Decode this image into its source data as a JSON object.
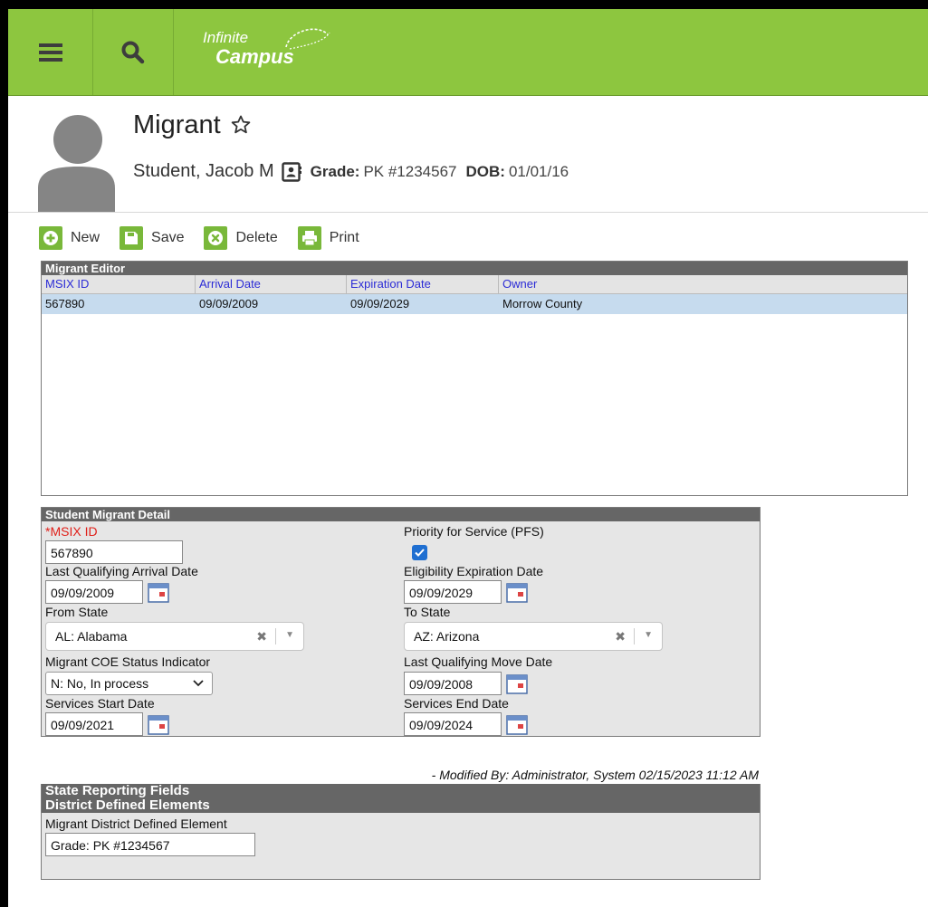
{
  "header": {
    "logo_line1": "Infinite",
    "logo_line2": "Campus",
    "page_title": "Migrant",
    "student_name": "Student, Jacob M",
    "grade_label": "Grade:",
    "grade_value": "PK #1234567",
    "dob_label": "DOB:",
    "dob_value": "01/01/16"
  },
  "toolbar": {
    "new_label": "New",
    "save_label": "Save",
    "delete_label": "Delete",
    "print_label": "Print"
  },
  "editor": {
    "title": "Migrant Editor",
    "columns": [
      "MSIX ID",
      "Arrival Date",
      "Expiration Date",
      "Owner"
    ],
    "rows": [
      [
        "567890",
        "09/09/2009",
        "09/09/2029",
        "Morrow County"
      ]
    ]
  },
  "detail": {
    "title": "Student Migrant Detail",
    "msix_required_mark": "*",
    "msix_label": "MSIX ID",
    "msix_value": "567890",
    "pfs_label": "Priority for Service (PFS)",
    "pfs_checked": true,
    "arrival_label": "Last Qualifying Arrival Date",
    "arrival_value": "09/09/2009",
    "expiration_label": "Eligibility Expiration Date",
    "expiration_value": "09/09/2029",
    "from_state_label": "From State",
    "from_state_value": "AL: Alabama",
    "to_state_label": "To State",
    "to_state_value": "AZ: Arizona",
    "coe_label": "Migrant COE Status Indicator",
    "coe_value": "N: No, In process",
    "move_label": "Last Qualifying Move Date",
    "move_value": "09/09/2008",
    "svc_start_label": "Services Start Date",
    "svc_start_value": "09/09/2021",
    "svc_end_label": "Services End Date",
    "svc_end_value": "09/09/2024",
    "modified_text": "- Modified By: Administrator, System 02/15/2023 11:12 AM"
  },
  "state_reporting": {
    "title": "State Reporting Fields",
    "subtitle": "District Defined Elements",
    "field_label": "Migrant District Defined Element",
    "field_value": "Grade: PK #1234567"
  },
  "colors": {
    "topbar": "#8dc63f",
    "toolbar_icon": "#79b83a",
    "panel_header": "#666666",
    "selected_row": "#c6dbee",
    "column_link": "#2b2bd6",
    "required": "#e0201a"
  }
}
